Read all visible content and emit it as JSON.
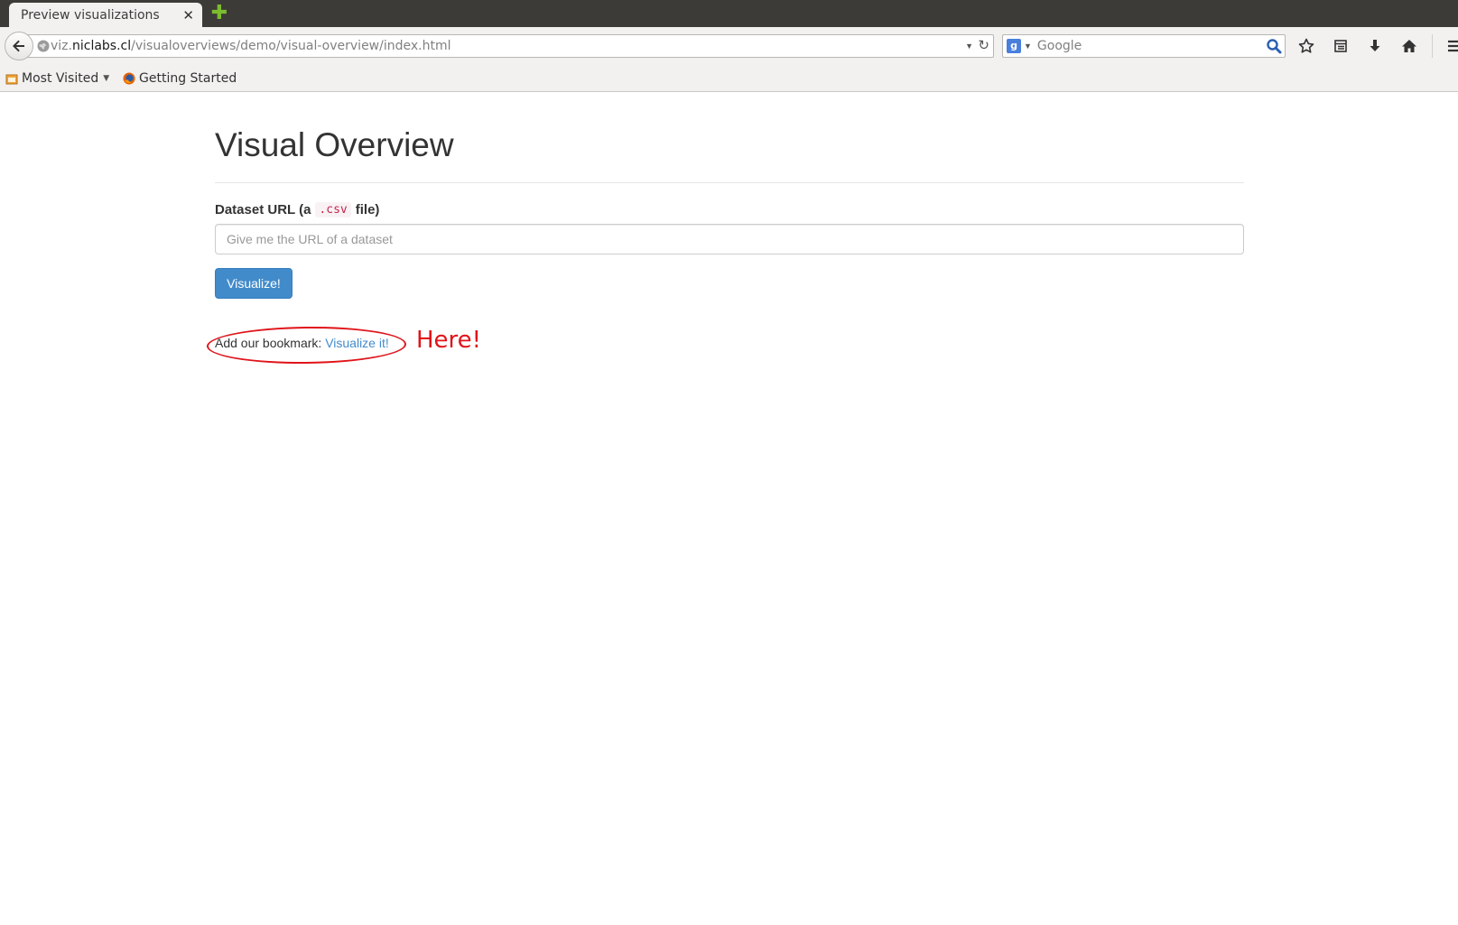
{
  "browser": {
    "tab_title": "Preview visualizations",
    "url_host_prefix": "viz.",
    "url_host": "niclabs.cl",
    "url_path": "/visualoverviews/demo/visual-overview/index.html",
    "search_placeholder": "Google",
    "search_engine_letter": "g",
    "bookmarks": [
      {
        "label": "Most Visited"
      },
      {
        "label": "Getting Started"
      }
    ],
    "icons": [
      "back-arrow-icon",
      "globe-icon",
      "url-dropdown-icon",
      "reload-icon",
      "search-engine-icon",
      "magnifier-icon",
      "star-icon",
      "reading-list-icon",
      "download-icon",
      "home-icon",
      "menu-icon",
      "new-tab-icon",
      "close-icon"
    ]
  },
  "page": {
    "title": "Visual Overview",
    "field_label_prefix": "Dataset URL (a",
    "field_label_code": ".csv",
    "field_label_suffix": "file)",
    "input_placeholder": "Give me the URL of a dataset",
    "input_value": "",
    "submit_label": "Visualize!",
    "bookmark_prefix": "Add our bookmark:",
    "bookmark_link": "Visualize it!",
    "link_color": "#428bca",
    "button_color": "#428bca"
  },
  "annotation": {
    "text": "Here!",
    "color": "#e0141a"
  }
}
